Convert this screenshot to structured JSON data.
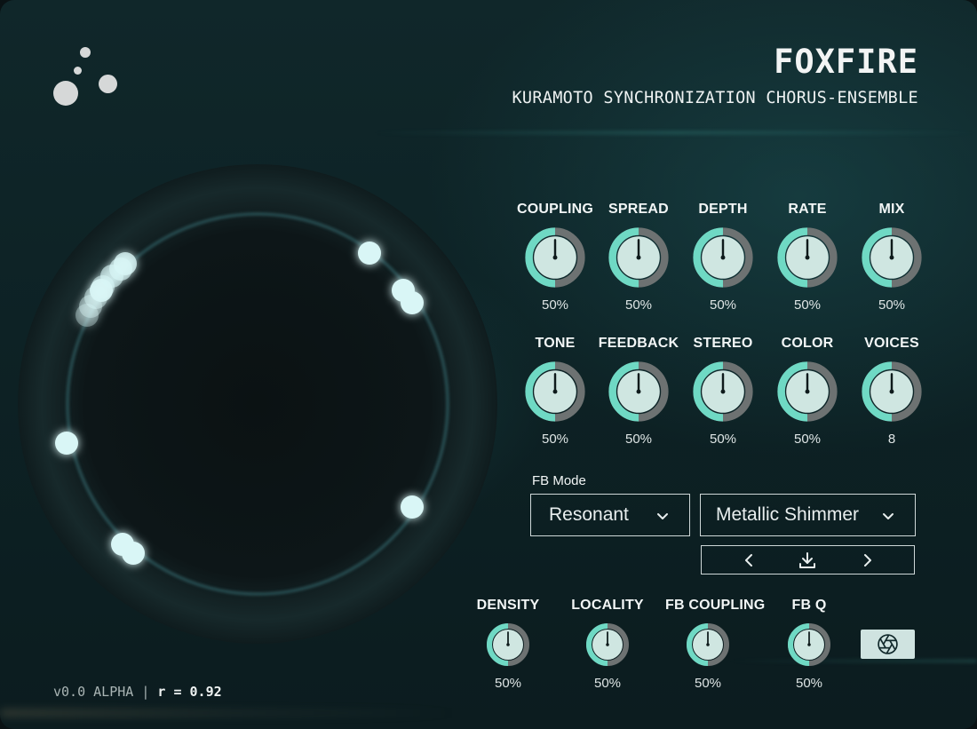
{
  "header": {
    "title": "FOXFIRE",
    "subtitle": "KURAMOTO SYNCHRONIZATION CHORUS-ENSEMBLE"
  },
  "colors": {
    "accent": "#6fd9c4",
    "knob_face": "#cfe6e1",
    "knob_track": "#6d7272",
    "oscillator_glow": "#8fe9f2"
  },
  "knobs_row1": [
    {
      "label": "COUPLING",
      "value": "50%",
      "level": 0.5
    },
    {
      "label": "SPREAD",
      "value": "50%",
      "level": 0.5
    },
    {
      "label": "DEPTH",
      "value": "50%",
      "level": 0.5
    },
    {
      "label": "RATE",
      "value": "50%",
      "level": 0.5
    },
    {
      "label": "MIX",
      "value": "50%",
      "level": 0.5
    }
  ],
  "knobs_row2": [
    {
      "label": "TONE",
      "value": "50%",
      "level": 0.5
    },
    {
      "label": "FEEDBACK",
      "value": "50%",
      "level": 0.5
    },
    {
      "label": "STEREO",
      "value": "50%",
      "level": 0.5
    },
    {
      "label": "COLOR",
      "value": "50%",
      "level": 0.5
    },
    {
      "label": "VOICES",
      "value": "8",
      "level": 0.5
    }
  ],
  "fb": {
    "mode_label": "FB Mode",
    "mode_value": "Resonant",
    "preset_value": "Metallic Shimmer"
  },
  "knobs_bottom": [
    {
      "label": "DENSITY",
      "value": "50%",
      "level": 0.5
    },
    {
      "label": "LOCALITY",
      "value": "50%",
      "level": 0.5
    },
    {
      "label": "FB COUPLING",
      "value": "50%",
      "level": 0.5
    },
    {
      "label": "FB Q",
      "value": "50%",
      "level": 0.5
    }
  ],
  "footer": {
    "version": "v0.0 ALPHA",
    "separator": "|",
    "r_label": "r =",
    "r_value": "0.92"
  },
  "icons": {
    "logo": "three-dots-logo",
    "dropdown": "chevron-down-icon",
    "prev": "chevron-left-icon",
    "save": "download-icon",
    "next": "chevron-right-icon",
    "snapshot": "aperture-icon"
  }
}
